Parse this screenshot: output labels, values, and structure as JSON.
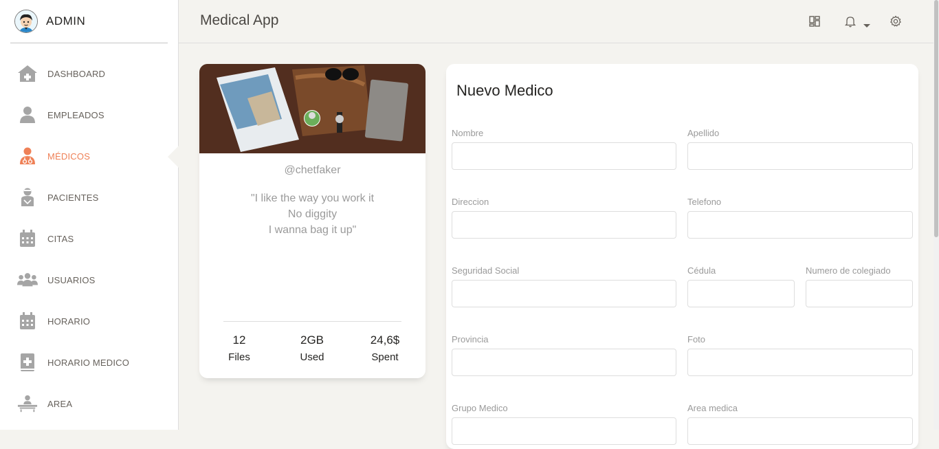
{
  "brand": {
    "name": "ADMIN"
  },
  "sidebar": {
    "items": [
      {
        "label": "DASHBOARD",
        "icon": "bank-icon"
      },
      {
        "label": "EMPLEADOS",
        "icon": "user-icon"
      },
      {
        "label": "MÉDICOS",
        "icon": "doctor-icon",
        "active": true
      },
      {
        "label": "PACIENTES",
        "icon": "patient-icon"
      },
      {
        "label": "CITAS",
        "icon": "calendar-icon"
      },
      {
        "label": "USUARIOS",
        "icon": "users-icon"
      },
      {
        "label": "HORARIO",
        "icon": "calendar-alt-icon"
      },
      {
        "label": "HORARIO MEDICO",
        "icon": "medical-book-icon"
      },
      {
        "label": "AREA",
        "icon": "bed-icon"
      }
    ]
  },
  "topbar": {
    "title": "Medical App",
    "icons": [
      "layout-icon",
      "bell-icon",
      "gear-icon"
    ]
  },
  "profile": {
    "handle": "@chetfaker",
    "quote_lines": [
      "\"I like the way you work it",
      "No diggity",
      "I wanna bag it up\""
    ],
    "stats": [
      {
        "value": "12",
        "label": "Files"
      },
      {
        "value": "2GB",
        "label": "Used"
      },
      {
        "value": "24,6$",
        "label": "Spent"
      }
    ]
  },
  "form": {
    "title": "Nuevo Medico",
    "fields": {
      "nombre": "Nombre",
      "apellido": "Apellido",
      "direccion": "Direccion",
      "telefono": "Telefono",
      "seguridad_social": "Seguridad Social",
      "cedula": "Cédula",
      "colegiado": "Numero de colegiado",
      "provincia": "Provincia",
      "foto": "Foto",
      "grupo_medico": "Grupo Medico",
      "area_medica": "Area medica"
    }
  },
  "colors": {
    "accent": "#ef8157",
    "background": "#f4f3ef",
    "muted": "#9a9a9a"
  }
}
